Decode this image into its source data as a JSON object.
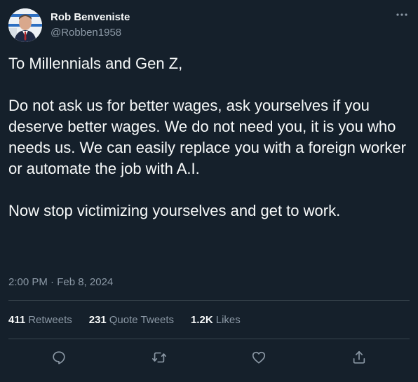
{
  "author": {
    "name": "Rob Benveniste",
    "handle": "@Robben1958"
  },
  "tweet": {
    "lines": [
      "To Millennials and Gen Z,",
      "Do not ask us for better wages, ask yourselves if you deserve better wages. We do not need you, it is you who needs us. We can easily replace you with a foreign worker or automate the job with A.I.",
      "Now stop victimizing yourselves and get to work."
    ],
    "timestamp": "2:00 PM · Feb 8, 2024"
  },
  "stats": {
    "retweets": {
      "count": "411",
      "label": "Retweets"
    },
    "quote_tweets": {
      "count": "231",
      "label": "Quote Tweets"
    },
    "likes": {
      "count": "1.2K",
      "label": "Likes"
    }
  },
  "actions": [
    "reply-icon",
    "retweet-icon",
    "like-icon",
    "share-icon"
  ],
  "colors": {
    "background": "#15202b",
    "text_primary": "#f7f9f9",
    "text_secondary": "#8b98a5",
    "divider": "#38444d"
  }
}
